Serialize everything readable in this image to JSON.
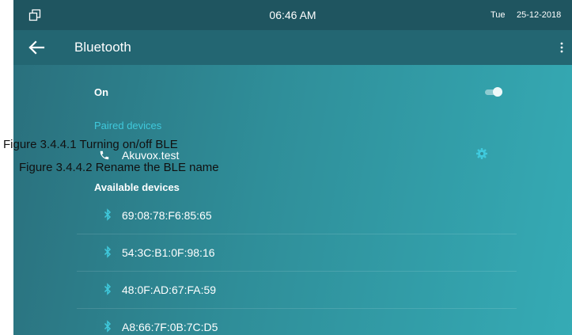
{
  "status_bar": {
    "window_icon": "window-restore-icon",
    "time": "06:46 AM",
    "day": "Tue",
    "date": "25-12-2018"
  },
  "app_bar": {
    "back_icon": "arrow-left-icon",
    "title": "Bluetooth",
    "menu_icon": "more-vertical-icon"
  },
  "bluetooth": {
    "on_label": "On",
    "enabled": true,
    "paired_header": "Paired devices",
    "paired_devices": [
      {
        "name": "Akuvox.test",
        "icon": "phone-icon",
        "settings_icon": "gear-icon"
      }
    ],
    "available_header": "Available devices",
    "available_devices": [
      {
        "name": "69:08:78:F6:85:65"
      },
      {
        "name": "54:3C:B1:0F:98:16"
      },
      {
        "name": "48:0F:AD:67:FA:59"
      },
      {
        "name": "A8:66:7F:0B:7C:D5"
      }
    ]
  },
  "captions": {
    "caption_1": "Figure 3.4.4.1 Turning on/off    BLE",
    "caption_2": "Figure 3.4.4.2 Rename the BLE name"
  },
  "colors": {
    "status_bar": "#1f5560",
    "app_bar": "#236672",
    "accent": "#3fc9dc",
    "gradient_start": "#2a6f7c",
    "gradient_end": "#35abb5"
  }
}
